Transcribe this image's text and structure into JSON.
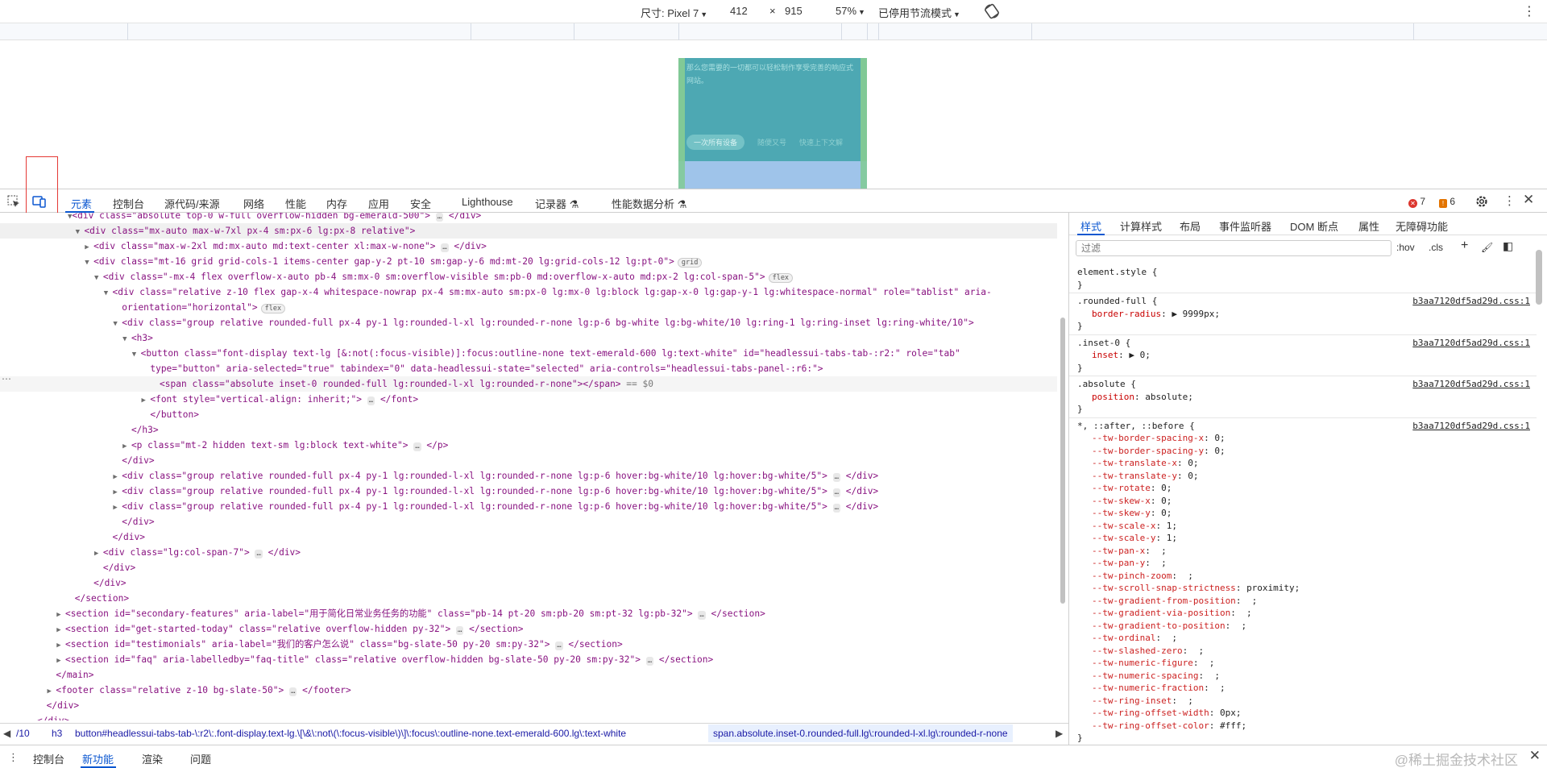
{
  "device_toolbar": {
    "size_label": "尺寸: Pixel 7",
    "width": "412",
    "times": "×",
    "height": "915",
    "zoom": "57%",
    "throttle": "已停用节流模式"
  },
  "phone_preview": {
    "text": "那么您需要的一切都可以轻松制作享受完善的响应式网站。",
    "tabs": [
      "一次所有设备",
      "随便又号",
      "快速上下文解"
    ]
  },
  "devtools_tabs": [
    "元素",
    "控制台",
    "源代码/来源",
    "网络",
    "性能",
    "内存",
    "应用",
    "安全",
    "Lighthouse",
    "记录器",
    "性能数据分析"
  ],
  "errors_count": "7",
  "warnings_count": "6",
  "elements": {
    "line0": "<div class=\"absolute top-0 w-full overflow-hidden bg-emerald-500\">",
    "lines": [
      {
        "indent": 8,
        "arrow": "▼",
        "html": "<div class=\"mx-auto max-w-7xl px-4 sm:px-6 lg:px-8 relative\">"
      },
      {
        "indent": 9,
        "arrow": "▶",
        "html": "<div class=\"max-w-2xl md:mx-auto md:text-center xl:max-w-none\">",
        "tail": "</div>"
      },
      {
        "indent": 9,
        "arrow": "▼",
        "html": "<div class=\"mt-16 grid grid-cols-1 items-center gap-y-2 pt-10 sm:gap-y-6 md:mt-20 lg:grid-cols-12 lg:pt-0\">",
        "badge": "grid"
      },
      {
        "indent": 10,
        "arrow": "▼",
        "html": "<div class=\"-mx-4 flex overflow-x-auto pb-4 sm:mx-0 sm:overflow-visible sm:pb-0 md:overflow-x-auto md:px-2 lg:col-span-5\">",
        "badge": "flex"
      },
      {
        "indent": 11,
        "arrow": "▼",
        "html": "<div class=\"relative z-10 flex gap-x-4 whitespace-nowrap px-4 sm:mx-auto sm:px-0 lg:mx-0 lg:block lg:gap-x-0 lg:gap-y-1 lg:whitespace-normal\" role=\"tablist\" aria-"
      },
      {
        "indent": 12,
        "arrow": "",
        "html": "orientation=\"horizontal\">",
        "badge": "flex"
      },
      {
        "indent": 12,
        "arrow": "▼",
        "html": "<div class=\"group relative rounded-full px-4 py-1 lg:rounded-l-xl lg:rounded-r-none lg:p-6 bg-white lg:bg-white/10 lg:ring-1 lg:ring-inset lg:ring-white/10\">"
      },
      {
        "indent": 13,
        "arrow": "▼",
        "html": "<h3>"
      },
      {
        "indent": 14,
        "arrow": "▼",
        "html": "<button class=\"font-display text-lg [&:not(:focus-visible)]:focus:outline-none text-emerald-600 lg:text-white\" id=\"headlessui-tabs-tab-:r2:\" role=\"tab\""
      },
      {
        "indent": 15,
        "arrow": "",
        "html": "type=\"button\" aria-selected=\"true\" tabindex=\"0\" data-headlessui-state=\"selected\" aria-controls=\"headlessui-tabs-panel-:r6:\">"
      },
      {
        "indent": 16,
        "arrow": "",
        "html": "<span class=\"absolute inset-0 rounded-full lg:rounded-l-xl lg:rounded-r-none\"></span>",
        "dollar": " == $0"
      },
      {
        "indent": 15,
        "arrow": "▶",
        "html": "<font style=\"vertical-align: inherit;\">",
        "tail": "</font>"
      },
      {
        "indent": 15,
        "arrow": "",
        "html": "</button>"
      },
      {
        "indent": 13,
        "arrow": "",
        "html": "</h3>"
      },
      {
        "indent": 13,
        "arrow": "▶",
        "html": "<p class=\"mt-2 hidden text-sm lg:block text-white\">",
        "tail": "</p>"
      },
      {
        "indent": 12,
        "arrow": "",
        "html": "</div>"
      },
      {
        "indent": 12,
        "arrow": "▶",
        "html": "<div class=\"group relative rounded-full px-4 py-1 lg:rounded-l-xl lg:rounded-r-none lg:p-6 hover:bg-white/10 lg:hover:bg-white/5\">",
        "tail": "</div>"
      },
      {
        "indent": 12,
        "arrow": "▶",
        "html": "<div class=\"group relative rounded-full px-4 py-1 lg:rounded-l-xl lg:rounded-r-none lg:p-6 hover:bg-white/10 lg:hover:bg-white/5\">",
        "tail": "</div>"
      },
      {
        "indent": 12,
        "arrow": "▶",
        "html": "<div class=\"group relative rounded-full px-4 py-1 lg:rounded-l-xl lg:rounded-r-none lg:p-6 hover:bg-white/10 lg:hover:bg-white/5\">",
        "tail": "</div>"
      },
      {
        "indent": 12,
        "arrow": "",
        "html": "</div>"
      },
      {
        "indent": 11,
        "arrow": "",
        "html": "</div>"
      },
      {
        "indent": 10,
        "arrow": "▶",
        "html": "<div class=\"lg:col-span-7\">",
        "tail": "</div>"
      },
      {
        "indent": 10,
        "arrow": "",
        "html": "</div>"
      },
      {
        "indent": 9,
        "arrow": "",
        "html": "</div>"
      },
      {
        "indent": 7,
        "arrow": "",
        "html": "</section>"
      },
      {
        "indent": 6,
        "arrow": "▶",
        "html": "<section id=\"secondary-features\" aria-label=\"用于简化日常业务任务的功能\" class=\"pb-14 pt-20 sm:pb-20 sm:pt-32 lg:pb-32\">",
        "tail": "</section>"
      },
      {
        "indent": 6,
        "arrow": "▶",
        "html": "<section id=\"get-started-today\" class=\"relative overflow-hidden py-32\">",
        "tail": "</section>"
      },
      {
        "indent": 6,
        "arrow": "▶",
        "html": "<section id=\"testimonials\" aria-label=\"我们的客户怎么说\" class=\"bg-slate-50 py-20 sm:py-32\">",
        "tail": "</section>"
      },
      {
        "indent": 6,
        "arrow": "▶",
        "html": "<section id=\"faq\" aria-labelledby=\"faq-title\" class=\"relative overflow-hidden bg-slate-50 py-20 sm:py-32\">",
        "tail": "</section>"
      },
      {
        "indent": 5,
        "arrow": "",
        "html": "</main>"
      },
      {
        "indent": 5,
        "arrow": "▶",
        "html": "<footer class=\"relative z-10 bg-slate-50\">",
        "tail": "</footer>"
      },
      {
        "indent": 4,
        "arrow": "",
        "html": "</div>"
      },
      {
        "indent": 3,
        "arrow": "",
        "html": "</div>"
      }
    ]
  },
  "breadcrumbs": [
    "/10",
    "h3",
    "button#headlessui-tabs-tab-\\:r2\\:.font-display.text-lg.\\[\\&\\:not\\(\\:focus-visible\\)\\]\\:focus\\:outline-none.text-emerald-600.lg\\:text-white",
    "span.absolute.inset-0.rounded-full.lg\\:rounded-l-xl.lg\\:rounded-r-none"
  ],
  "styles_tabs": [
    "样式",
    "计算样式",
    "布局",
    "事件监听器",
    "DOM 断点",
    "属性",
    "无障碍功能"
  ],
  "filter_placeholder": "过滤",
  "filter_tools": [
    ":hov",
    ".cls"
  ],
  "rules": [
    {
      "selector": "element.style {",
      "props": [],
      "src": ""
    },
    {
      "selector": ".rounded-full {",
      "src": "b3aa7120df5ad29d.css:1",
      "props": [
        [
          "border-radius",
          "▶ 9999px;"
        ]
      ]
    },
    {
      "selector": ".inset-0 {",
      "src": "b3aa7120df5ad29d.css:1",
      "props": [
        [
          "inset",
          "▶ 0;"
        ]
      ]
    },
    {
      "selector": ".absolute {",
      "src": "b3aa7120df5ad29d.css:1",
      "props": [
        [
          "position",
          "absolute;"
        ]
      ]
    },
    {
      "selector": "*, ::after, ::before {",
      "src": "b3aa7120df5ad29d.css:1",
      "props": [
        [
          "--tw-border-spacing-x",
          "0;"
        ],
        [
          "--tw-border-spacing-y",
          "0;"
        ],
        [
          "--tw-translate-x",
          "0;"
        ],
        [
          "--tw-translate-y",
          "0;"
        ],
        [
          "--tw-rotate",
          "0;"
        ],
        [
          "--tw-skew-x",
          "0;"
        ],
        [
          "--tw-skew-y",
          "0;"
        ],
        [
          "--tw-scale-x",
          "1;"
        ],
        [
          "--tw-scale-y",
          "1;"
        ],
        [
          "--tw-pan-x",
          " ;"
        ],
        [
          "--tw-pan-y",
          " ;"
        ],
        [
          "--tw-pinch-zoom",
          " ;"
        ],
        [
          "--tw-scroll-snap-strictness",
          "proximity;"
        ],
        [
          "--tw-gradient-from-position",
          " ;"
        ],
        [
          "--tw-gradient-via-position",
          " ;"
        ],
        [
          "--tw-gradient-to-position",
          " ;"
        ],
        [
          "--tw-ordinal",
          " ;"
        ],
        [
          "--tw-slashed-zero",
          " ;"
        ],
        [
          "--tw-numeric-figure",
          " ;"
        ],
        [
          "--tw-numeric-spacing",
          " ;"
        ],
        [
          "--tw-numeric-fraction",
          " ;"
        ],
        [
          "--tw-ring-inset",
          " ;"
        ],
        [
          "--tw-ring-offset-width",
          "0px;"
        ],
        [
          "--tw-ring-offset-color",
          "#fff;"
        ]
      ]
    }
  ],
  "drawer_tabs": [
    "控制台",
    "新功能",
    "渲染",
    "问题"
  ],
  "watermark": "@稀土掘金技术社区"
}
